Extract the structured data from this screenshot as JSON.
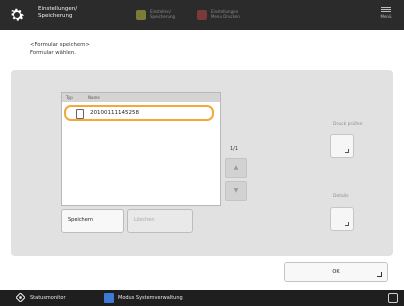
{
  "header": {
    "title_line1": "Einstellungen/",
    "title_line2": "Speicherung",
    "btn1_line1": "Einstellen/",
    "btn1_line2": "Speicherung",
    "btn2_line1": "Einstellungen",
    "btn2_line2": "Menu Drucken",
    "menu_label": "Menü"
  },
  "instruction": {
    "line1": "<Formular speichern>",
    "line2": "Formular wählen."
  },
  "list": {
    "col_type": "Typ",
    "col_name": "Name",
    "rows": [
      {
        "name": "20100111145258",
        "selected": true,
        "icon": "document-icon"
      }
    ]
  },
  "pager": {
    "indicator": "1/1",
    "up": "▲",
    "down": "▼"
  },
  "side": {
    "check_print_label": "Druck prüfen",
    "details_label": "Details"
  },
  "buttons": {
    "save": "Speichern",
    "delete": "Löschen",
    "ok": "OK"
  },
  "footer": {
    "status_monitor": "Statusmonitor",
    "system_mode": "Modus Systemverwaltung",
    "network_icon": "network-icon"
  },
  "colors": {
    "header_bg": "#2b2b2b",
    "selection_border": "#f2a83b",
    "panel_bg": "#e1e1e1",
    "footer_bg": "#1f1f1f",
    "system_icon": "#3b7bd6"
  }
}
